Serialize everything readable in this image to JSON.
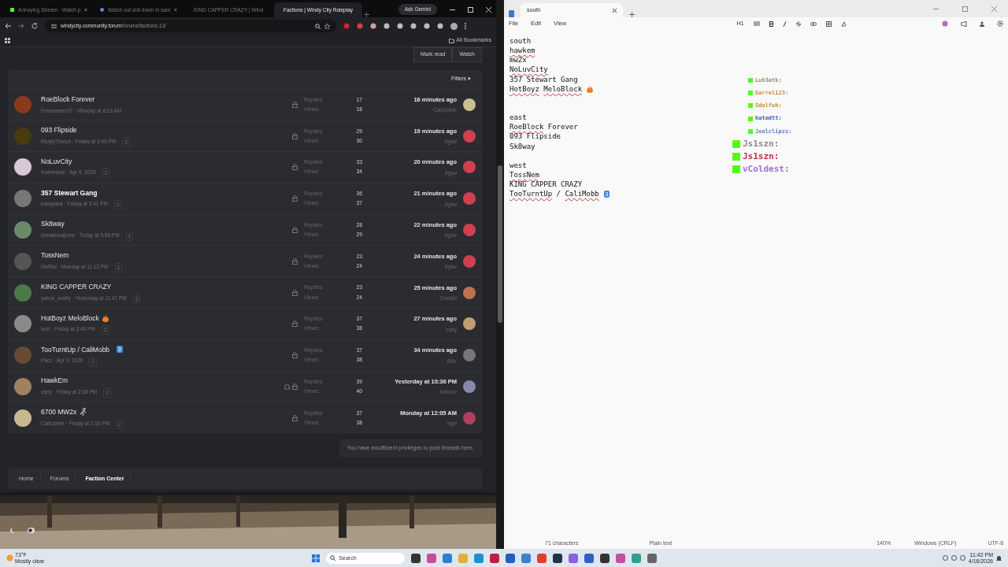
{
  "browser": {
    "tabs": [
      {
        "label": "Annoying Stream - Watch p",
        "selected": false
      },
      {
        "label": "Watch out shit down in sam",
        "selected": false
      },
      {
        "label": "KING CAPPER CRAZY | Wind",
        "selected": false
      },
      {
        "label": "Factions | Windy City Roleplay",
        "selected": true
      }
    ],
    "ask_gemini": "Ask Gemini",
    "url_host": "windycity.community.forum",
    "url_path": "/forums/factions.13/",
    "bookmarks": "All Bookmarks"
  },
  "forum": {
    "actions": [
      "Mark read",
      "Watch"
    ],
    "filters": "Filters ▾",
    "threads": [
      {
        "title": "RoeBlock Forever",
        "unread": false,
        "meta": "Freedamen37 · Monday at 8:23 AM",
        "watched": false,
        "replies_label": "Replies:",
        "replies": "17",
        "views_label": "Views:",
        "views": "18",
        "last_time": "16 minutes ago",
        "last_user": "CaliUplefe"
      },
      {
        "title": "093 Flipside",
        "unread": false,
        "meta": "ReallyTrench · Friday at 3:49 PM",
        "pages": "2",
        "watched": false,
        "replies_label": "Replies:",
        "replies": "29",
        "views_label": "Views:",
        "views": "30",
        "last_time": "19 minutes ago",
        "last_user": "Jigsw"
      },
      {
        "title": "NoLuvCity",
        "unread": false,
        "meta": "Kweenbee · Apr 9, 2026",
        "pages": "2",
        "watched": false,
        "replies_label": "Replies:",
        "replies": "33",
        "views_label": "Views:",
        "views": "34",
        "last_time": "20 minutes ago",
        "last_user": "Jigsw"
      },
      {
        "title": "357 Stewart Gang",
        "unread": true,
        "meta": "kdcapalot · Friday at 3:41 PM",
        "pages": "2",
        "watched": false,
        "replies_label": "Replies:",
        "replies": "36",
        "views_label": "Views:",
        "views": "37",
        "last_time": "21 minutes ago",
        "last_user": "Jigsw"
      },
      {
        "title": "Sk8way",
        "unread": false,
        "meta": "drewskicapone · Today at 5:56 PM",
        "pages": "2",
        "watched": false,
        "replies_label": "Replies:",
        "replies": "28",
        "views_label": "Views:",
        "views": "29",
        "last_time": "22 minutes ago",
        "last_user": "Jigsw"
      },
      {
        "title": "TossNem",
        "unread": false,
        "meta": "MeRkz · Monday at 11:13 PM",
        "pages": "2",
        "watched": false,
        "replies_label": "Replies:",
        "replies": "23",
        "views_label": "Views:",
        "views": "24",
        "last_time": "24 minutes ago",
        "last_user": "Jigsw"
      },
      {
        "title": "KING CAPPER CRAZY",
        "unread": false,
        "meta": "yabox_smitty · Yesterday at 11:47 PM",
        "pages": "2",
        "watched": false,
        "replies_label": "Replies:",
        "replies": "23",
        "views_label": "Views:",
        "views": "24",
        "last_time": "25 minutes ago",
        "last_user": "Dreskiii"
      },
      {
        "title": "HotBoyz MeloBlock",
        "badge": {
          "kind": "flame"
        },
        "unread": false,
        "meta": "kezl · Friday at 3:46 PM",
        "pages": "2",
        "watched": false,
        "replies_label": "Replies:",
        "replies": "37",
        "views_label": "Views:",
        "views": "38",
        "last_time": "27 minutes ago",
        "last_user": "zarty"
      },
      {
        "title": "TooTurntUp / CaliMobb",
        "badge": {
          "kind": "keycap",
          "text": "3"
        },
        "unread": false,
        "meta": "Pacc · Apr 9, 2026",
        "pages": "2",
        "watched": false,
        "replies_label": "Replies:",
        "replies": "37",
        "views_label": "Views:",
        "views": "38",
        "last_time": "34 minutes ago",
        "last_user": "Blitz"
      },
      {
        "title": "HawkEm",
        "unread": false,
        "meta": "zarty · Friday at 2:38 PM",
        "pages": "2",
        "watched": true,
        "replies_label": "Replies:",
        "replies": "39",
        "views_label": "Views:",
        "views": "40",
        "last_time": "Yesterday at 10:36 PM",
        "last_user": "kotourz"
      },
      {
        "title": "6700 MW2x",
        "badge": {
          "kind": "runner"
        },
        "unread": false,
        "meta": "CaliUplefe · Friday at 2:19 PM",
        "pages": "2",
        "watched": false,
        "replies_label": "Replies:",
        "replies": "37",
        "views_label": "Views:",
        "views": "38",
        "last_time": "Monday at 12:05 AM",
        "last_user": "itgel"
      }
    ],
    "notice": "You have insufficient privileges to post threads here.",
    "breadcrumbs": [
      {
        "label": "Home",
        "current": false
      },
      {
        "label": "Forums",
        "current": false
      },
      {
        "label": "Faction Center",
        "current": true
      }
    ]
  },
  "notepad": {
    "tab": "south",
    "menu": [
      "File",
      "Edit",
      "View"
    ],
    "heading": "H1",
    "lines": [
      {
        "kind": "text",
        "segments": [
          {
            "text": "south",
            "flagged": false
          }
        ]
      },
      {
        "kind": "text",
        "segments": [
          {
            "text": "hawkem",
            "flagged": true
          }
        ]
      },
      {
        "kind": "text",
        "segments": [
          {
            "text": "mw2x",
            "flagged": false
          }
        ]
      },
      {
        "kind": "text",
        "segments": [
          {
            "text": "NoLuvCity",
            "flagged": true
          }
        ]
      },
      {
        "kind": "text",
        "segments": [
          {
            "text": "357 Stewart Gang",
            "flagged": false
          }
        ]
      },
      {
        "kind": "text",
        "segments": [
          {
            "text": "HotBoyz",
            "flagged": true
          },
          {
            "text": "MeloBlock",
            "flagged": true,
            "space_before": true
          }
        ],
        "badge": {
          "kind": "flame"
        }
      },
      {
        "kind": "blank"
      },
      {
        "kind": "blank"
      },
      {
        "kind": "text",
        "segments": [
          {
            "text": "east",
            "flagged": false
          }
        ]
      },
      {
        "kind": "text",
        "segments": [
          {
            "text": "RoeBlock",
            "flagged": true
          },
          {
            "text": "Forever",
            "flagged": false,
            "space_before": true
          }
        ]
      },
      {
        "kind": "text",
        "segments": [
          {
            "text": "093 Flipside",
            "flagged": false
          }
        ]
      },
      {
        "kind": "text",
        "segments": [
          {
            "text": "Sk8way",
            "flagged": false
          }
        ]
      },
      {
        "kind": "blank"
      },
      {
        "kind": "text",
        "segments": [
          {
            "text": "west",
            "flagged": false
          }
        ]
      },
      {
        "kind": "text",
        "segments": [
          {
            "text": "TossNem",
            "flagged": true
          }
        ]
      },
      {
        "kind": "text",
        "segments": [
          {
            "text": "KING CAPPER CRAZY",
            "flagged": false
          }
        ]
      },
      {
        "kind": "text",
        "segments": [
          {
            "text": "TooTurntUp",
            "flagged": true
          },
          {
            "text": "/",
            "flagged": false,
            "space_before": true
          },
          {
            "text": "CaliMobb",
            "flagged": true,
            "space_before": true
          }
        ],
        "badge": {
          "kind": "keycap",
          "text": "3"
        }
      }
    ],
    "status": [
      "71 characters",
      "Plain text",
      "140%",
      "Windows (CRLF)",
      "UTF-8"
    ]
  },
  "chat": [
    {
      "user": "Luh3atk:",
      "color": "#7f9466",
      "kind": "small"
    },
    {
      "user": "Garrel123:",
      "color": "#c98a4a",
      "kind": "small"
    },
    {
      "user": "Sdolfuh:",
      "color": "#c98a2a",
      "kind": "small"
    },
    {
      "user": "hatedtt:",
      "color": "#3a5eb0",
      "kind": "small"
    },
    {
      "user": "Joelclipzz:",
      "color": "#5a7ac8",
      "kind": "small"
    },
    {
      "user": "Js1szn:",
      "color": "#8a8a8a",
      "kind": "large"
    },
    {
      "user": "Js1szn:",
      "color": "#c0304a",
      "kind": "large"
    },
    {
      "user": "vColdest:",
      "color": "#a070e0",
      "kind": "large"
    }
  ],
  "taskbar": {
    "temp": "73°F",
    "weather": "Mostly clear",
    "search": "Search",
    "time": "11:42 PM",
    "date": "4/16/2026"
  }
}
